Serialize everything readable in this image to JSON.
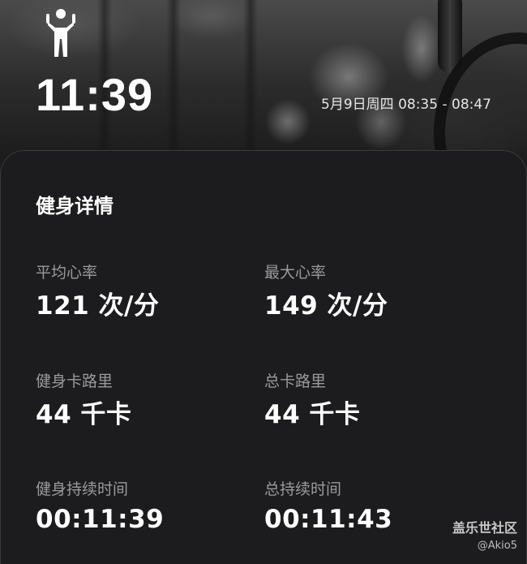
{
  "header": {
    "activity_icon": "strength-training-icon",
    "duration": "11:39",
    "session_time": "5月9日周四 08:35 - 08:47"
  },
  "details": {
    "title": "健身详情",
    "metrics": [
      {
        "label": "平均心率",
        "value": "121 次/分"
      },
      {
        "label": "最大心率",
        "value": "149 次/分"
      },
      {
        "label": "健身卡路里",
        "value": "44 千卡"
      },
      {
        "label": "总卡路里",
        "value": "44 千卡"
      },
      {
        "label": "健身持续时间",
        "value": "00:11:39"
      },
      {
        "label": "总持续时间",
        "value": "00:11:43"
      }
    ]
  },
  "watermark": {
    "brand": "盖乐世社区",
    "user": "@Akio5"
  },
  "colors": {
    "card_background": "#1c1c1e",
    "label_gray": "#9a9a9e",
    "text_white": "#ffffff"
  }
}
